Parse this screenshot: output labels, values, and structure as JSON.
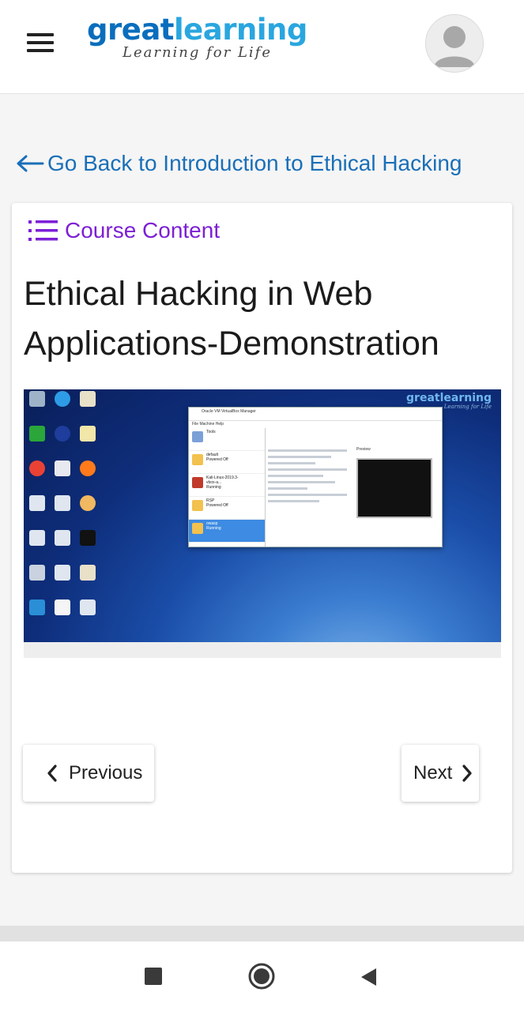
{
  "header": {
    "menu_icon": "hamburger-menu-icon",
    "logo": {
      "word_part1": "great",
      "word_part2": "learning",
      "tagline": "Learning for Life",
      "color_primary": "#0a6ebd",
      "color_secondary": "#2aa6df"
    },
    "avatar_icon": "user-avatar-icon"
  },
  "back_link": {
    "icon": "arrow-left-icon",
    "label": "Go Back to Introduction to Ethical Hacking",
    "color": "#1a6fb8"
  },
  "course_content": {
    "icon": "list-icon",
    "label": "Course Content",
    "color": "#7d1fd6"
  },
  "lesson": {
    "title": "Ethical Hacking in Web Applications-Demonstration",
    "video": {
      "watermark": "greatlearning",
      "watermark_tagline": "Learning for Life",
      "window_title": "Oracle VM VirtualBox Manager",
      "menu": "File   Machine   Help",
      "tools_label": "Tools",
      "vms": [
        {
          "name": "default",
          "status": "Powered Off"
        },
        {
          "name": "Kali-Linux-2019.3-vbox-a...",
          "status": "Running"
        },
        {
          "name": "RSP",
          "status": "Powered Off"
        },
        {
          "name": "owasp",
          "status": "Running"
        }
      ],
      "preview_label": "Preview"
    }
  },
  "nav": {
    "previous_label": "Previous",
    "previous_icon": "chevron-left-icon",
    "next_label": "Next",
    "next_icon": "chevron-right-icon"
  },
  "system_nav": {
    "recents_icon": "square-recents-icon",
    "home_icon": "circle-home-icon",
    "back_icon": "triangle-back-icon"
  }
}
